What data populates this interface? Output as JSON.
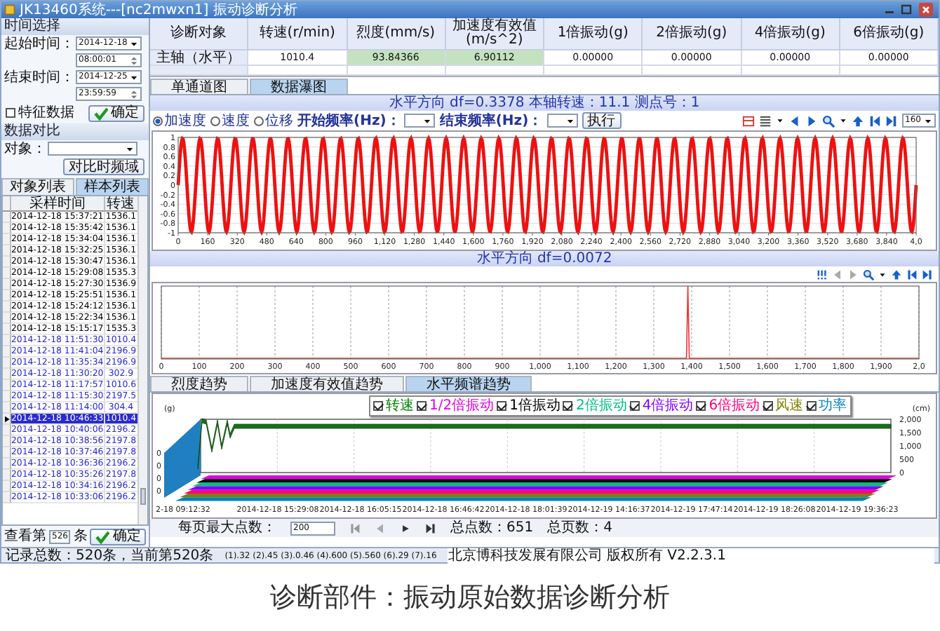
{
  "window": {
    "title": "JK13460系统---[nc2mwxn1] 振动诊断分析"
  },
  "time_select": {
    "title": "时间选择",
    "start_label": "起始时间：",
    "start_date": "2014-12-18",
    "start_time": "08:00:01",
    "end_label": "结束时间：",
    "end_date": "2014-12-25",
    "end_time": "23:59:59",
    "feature_checkbox": {
      "label": "特征数据",
      "checked": false
    },
    "confirm_button": "确定"
  },
  "compare": {
    "title": "数据对比",
    "object_label": "对象：",
    "button": "对比时频域"
  },
  "list_tabs": [
    {
      "label": "对象列表",
      "selected": false
    },
    {
      "label": "样本列表",
      "selected": true
    }
  ],
  "sample_table": {
    "columns": [
      "采样时间",
      "转速"
    ],
    "rows": [
      {
        "time": "2014-12-18 15:37:21",
        "speed": "1536.1",
        "color": "#000000",
        "selected": false
      },
      {
        "time": "2014-12-18 15:35:42",
        "speed": "1536.1",
        "color": "#000000",
        "selected": false
      },
      {
        "time": "2014-12-18 15:34:04",
        "speed": "1536.1",
        "color": "#000000",
        "selected": false
      },
      {
        "time": "2014-12-18 15:32:25",
        "speed": "1536.1",
        "color": "#000000",
        "selected": false
      },
      {
        "time": "2014-12-18 15:30:47",
        "speed": "1536.1",
        "color": "#000000",
        "selected": false
      },
      {
        "time": "2014-12-18 15:29:08",
        "speed": "1535.3",
        "color": "#000000",
        "selected": false
      },
      {
        "time": "2014-12-18 15:27:30",
        "speed": "1536.9",
        "color": "#000000",
        "selected": false
      },
      {
        "time": "2014-12-18 15:25:51",
        "speed": "1536.1",
        "color": "#000000",
        "selected": false
      },
      {
        "time": "2014-12-18 15:24:12",
        "speed": "1536.1",
        "color": "#000000",
        "selected": false
      },
      {
        "time": "2014-12-18 15:22:34",
        "speed": "1536.1",
        "color": "#000000",
        "selected": false
      },
      {
        "time": "2014-12-18 15:15:17",
        "speed": "1535.3",
        "color": "#000000",
        "selected": false
      },
      {
        "time": "2014-12-18 11:51:30",
        "speed": "1010.4",
        "color": "#2a2ad0",
        "selected": false
      },
      {
        "time": "2014-12-18 11:41:04",
        "speed": "2196.9",
        "color": "#2a2ad0",
        "selected": false
      },
      {
        "time": "2014-12-18 11:35:34",
        "speed": "2196.9",
        "color": "#2a2ad0",
        "selected": false
      },
      {
        "time": "2014-12-18 11:30:20",
        "speed": "302.9",
        "color": "#2a2ad0",
        "selected": false
      },
      {
        "time": "2014-12-18 11:17:57",
        "speed": "1010.6",
        "color": "#2a2ad0",
        "selected": false
      },
      {
        "time": "2014-12-18 11:15:30",
        "speed": "2197.5",
        "color": "#2a2ad0",
        "selected": false
      },
      {
        "time": "2014-12-18 11:14:00",
        "speed": "304.4",
        "color": "#2a2ad0",
        "selected": false
      },
      {
        "time": "2014-12-18 10:46:33",
        "speed": "1010.4",
        "color": "#2a2ad0",
        "selected": true
      },
      {
        "time": "2014-12-18 10:40:06",
        "speed": "2196.2",
        "color": "#2a2ad0",
        "selected": false
      },
      {
        "time": "2014-12-18 10:38:56",
        "speed": "2197.8",
        "color": "#2a2ad0",
        "selected": false
      },
      {
        "time": "2014-12-18 10:37:46",
        "speed": "2197.8",
        "color": "#2a2ad0",
        "selected": false
      },
      {
        "time": "2014-12-18 10:36:36",
        "speed": "2196.2",
        "color": "#2a2ad0",
        "selected": false
      },
      {
        "time": "2014-12-18 10:35:26",
        "speed": "2197.8",
        "color": "#2a2ad0",
        "selected": false
      },
      {
        "time": "2014-12-18 10:34:16",
        "speed": "2196.2",
        "color": "#2a2ad0",
        "selected": false
      },
      {
        "time": "2014-12-18 10:33:06",
        "speed": "2196.2",
        "color": "#2a2ad0",
        "selected": false
      }
    ]
  },
  "goto": {
    "prefix": "查看第",
    "value": "526",
    "suffix": "条",
    "button": "确定"
  },
  "summary_table": {
    "columns": [
      "诊断对象",
      "转速(r/min)",
      "烈度(mm/s)",
      "加速度有效值(m/s^2)",
      "1倍振动(g)",
      "2倍振动(g)",
      "4倍振动(g)",
      "6倍振动(g)"
    ],
    "rows": [
      {
        "cells": [
          {
            "text": "主轴（水平）",
            "highlight": false
          },
          {
            "text": "1010.4",
            "highlight": false
          },
          {
            "text": "93.84366",
            "highlight": true
          },
          {
            "text": "6.90112",
            "highlight": true
          },
          {
            "text": "0.00000",
            "highlight": false
          },
          {
            "text": "0.00000",
            "highlight": false
          },
          {
            "text": "0.00000",
            "highlight": false
          },
          {
            "text": "0.00000",
            "highlight": false
          }
        ]
      }
    ]
  },
  "chart_tabs": [
    {
      "label": "单通道图",
      "selected": false
    },
    {
      "label": "数据瀑图",
      "selected": true
    }
  ],
  "wave_info": "水平方向 df=0.3378 本轴转速：11.1 测点号：1",
  "wave_toolbar": {
    "modes": [
      {
        "label": "加速度",
        "selected": true
      },
      {
        "label": "速度",
        "selected": false
      },
      {
        "label": "位移",
        "selected": false
      }
    ],
    "start_freq_label": "开始频率(Hz)：",
    "end_freq_label": "结束频率(Hz)：",
    "run_button": "执行",
    "zoom_value": "160"
  },
  "waveform": {
    "y_ticks": [
      "1",
      "0.8",
      "0.6",
      "0.4",
      "0.2",
      "0",
      "-0.2",
      "-0.4",
      "-0.6",
      "-0.8",
      "-1"
    ],
    "x_ticks": [
      "0",
      "160",
      "320",
      "480",
      "640",
      "800",
      "960",
      "1,120",
      "1,280",
      "1,440",
      "1,600",
      "1,760",
      "1,920",
      "2,080",
      "2,240",
      "2,400",
      "2,560",
      "2,720",
      "2,880",
      "3,040",
      "3,200",
      "3,360",
      "3,520",
      "3,680",
      "3,840",
      "4,0"
    ]
  },
  "spectrum_info": "水平方向 df=0.0072",
  "spectrum": {
    "x_ticks": [
      "0",
      "100",
      "200",
      "300",
      "400",
      "500",
      "600",
      "700",
      "800",
      "900",
      "1,000",
      "1,100",
      "1,200",
      "1,300",
      "1,400",
      "1,500",
      "1,600",
      "1,700",
      "1,800",
      "1,900",
      "2,0"
    ]
  },
  "trend_tabs": [
    {
      "label": "烈度趋势",
      "selected": false
    },
    {
      "label": "加速度有效值趋势",
      "selected": false
    },
    {
      "label": "水平频谱趋势",
      "selected": true
    }
  ],
  "trend": {
    "left_unit": "(g)",
    "right_unit": "(cm)",
    "left_ticks": [
      "0",
      "0",
      "0",
      "0"
    ],
    "right_ticks": [
      "2,000",
      "1,500",
      "1,000",
      "500",
      "0"
    ],
    "legend": [
      {
        "label": "转速",
        "color": "#008000",
        "checked": true
      },
      {
        "label": "1/2倍振动",
        "color": "#e000e0",
        "checked": true
      },
      {
        "label": "1倍振动",
        "color": "#000000",
        "checked": true
      },
      {
        "label": "2倍振动",
        "color": "#00c080",
        "checked": true
      },
      {
        "label": "4倍振动",
        "color": "#8000ff",
        "checked": true
      },
      {
        "label": "6倍振动",
        "color": "#ff0080",
        "checked": true
      },
      {
        "label": "风速",
        "color": "#808000",
        "checked": true
      },
      {
        "label": "功率",
        "color": "#0080c0",
        "checked": true
      }
    ],
    "x_labels": [
      "2-18 09:12:32",
      "2014-12-18 15:29:08",
      "2014-12-18 16:05:15",
      "2014-12-18 16:46:42",
      "2014-12-18 18:01:39",
      "2014-12-19 14:16:37",
      "2014-12-19 17:47:14",
      "2014-12-19 18:26:08",
      "2014-12-19 19:36:23"
    ]
  },
  "pager": {
    "max_points_label": "每页最大点数：",
    "max_points_value": "200",
    "total_points": "总点数：651",
    "total_pages": "总页数：4"
  },
  "status_bar": {
    "left": "记录总数：520条，当前第520条",
    "middle": "(1).32 (2).45 (3).0.46 (4).600 (5).560 (6).29 (7).16",
    "right": "北京博科技发展有限公司 版权所有 V2.2.3.1"
  },
  "caption": "诊断部件：振动原始数据诊断分析"
}
